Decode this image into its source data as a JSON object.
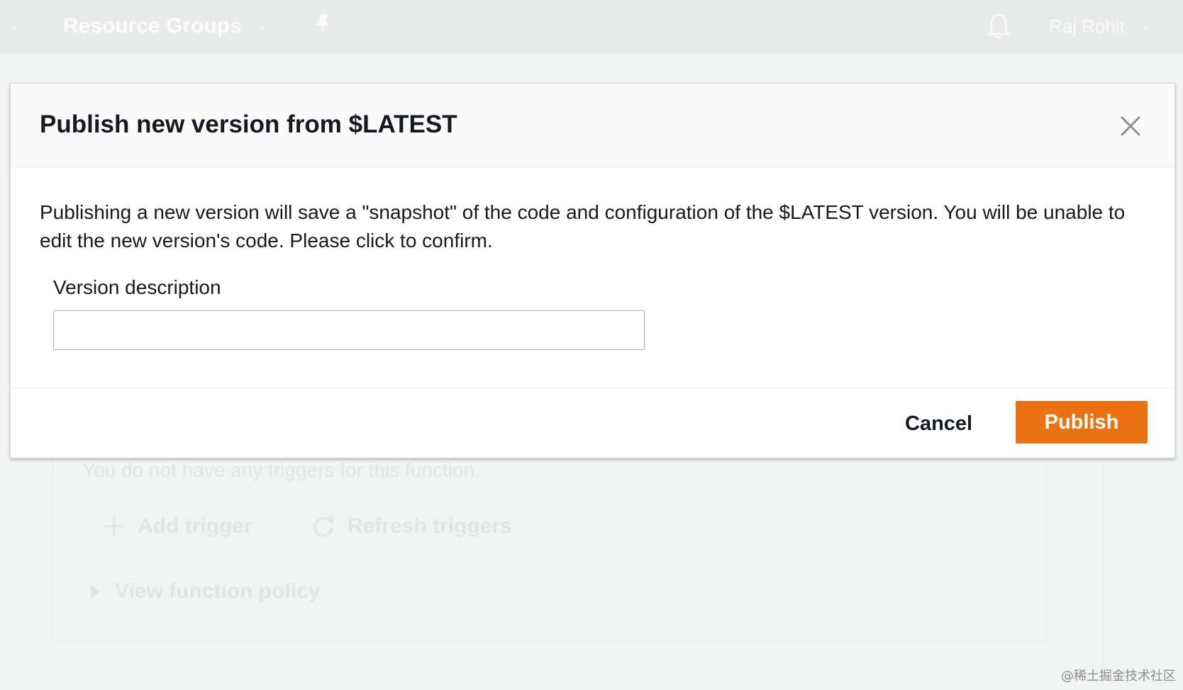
{
  "colors": {
    "accent": "#ec7211",
    "page_background": "#f2f3f3",
    "topbar": "#e9eaea",
    "modal_background": "#ffffff"
  },
  "topbar": {
    "menu_caret_icon": "chevron-down-icon",
    "resource_groups_label": "Resource Groups",
    "pin_icon": "pin-icon",
    "bell_icon": "bell-icon",
    "user_name": "Raj Rohit"
  },
  "background": {
    "no_triggers_text": "You do not have any triggers for this function.",
    "add_trigger_label": "Add trigger",
    "refresh_triggers_label": "Refresh triggers",
    "view_policy_label": "View function policy"
  },
  "modal": {
    "title": "Publish new version from $LATEST",
    "close_icon": "close-icon",
    "description": "Publishing a new version will save a \"snapshot\" of the code and configuration of the $LATEST version. You will be unable to edit the new version's code. Please click to confirm.",
    "version_description_label": "Version description",
    "version_description_value": "",
    "cancel_label": "Cancel",
    "publish_label": "Publish"
  },
  "watermark": "@稀土掘金技术社区"
}
